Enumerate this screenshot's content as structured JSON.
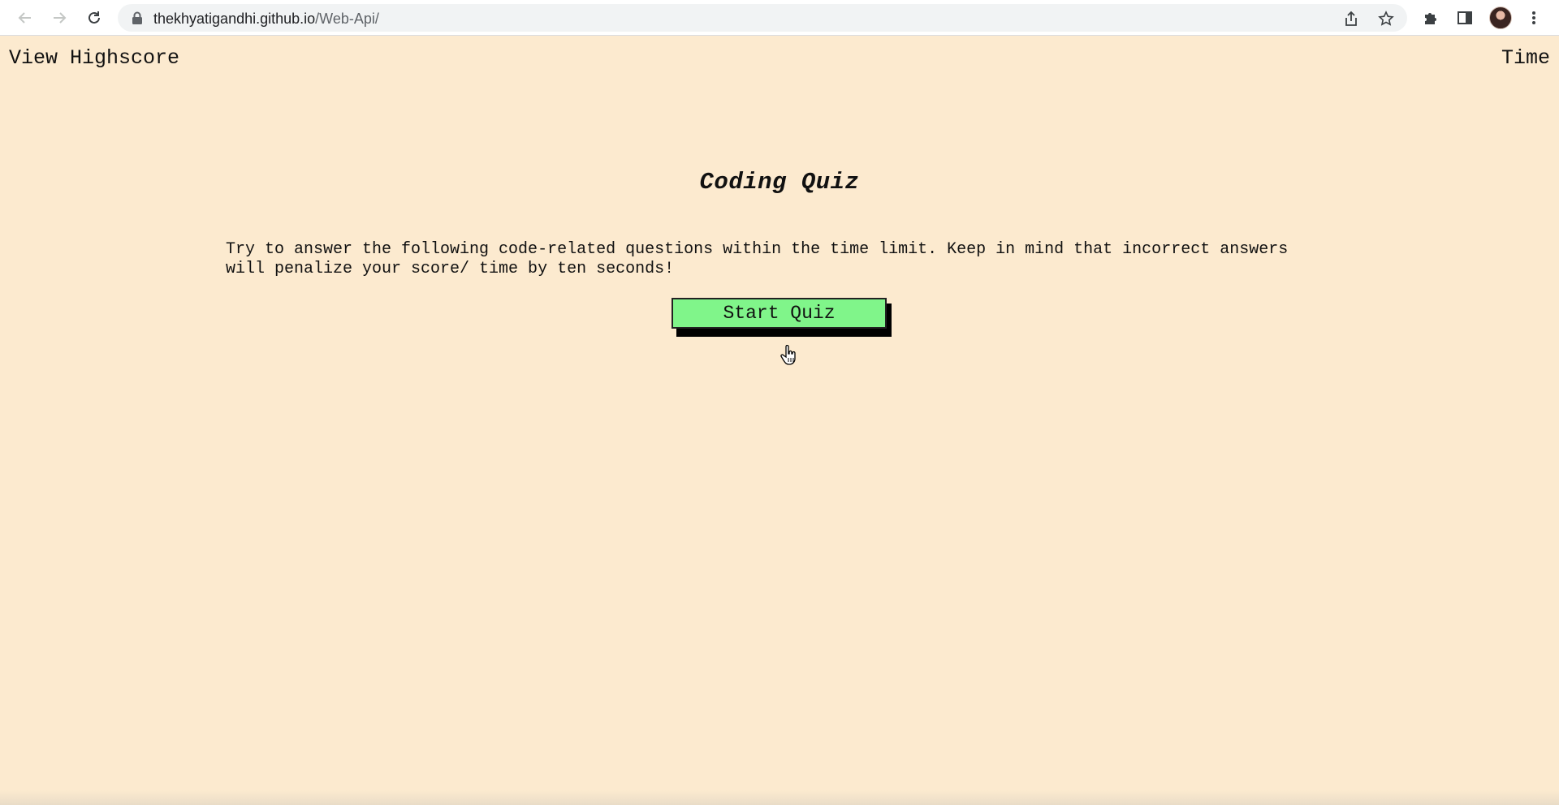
{
  "browser": {
    "url_domain": "thekhyatigandhi.github.io",
    "url_path": "/Web-Api/"
  },
  "icons": {
    "back": "arrow-left-icon",
    "forward": "arrow-right-icon",
    "reload": "reload-icon",
    "lock": "lock-icon",
    "share": "share-icon",
    "bookmark": "star-icon",
    "extensions": "puzzle-icon",
    "side_panel": "side-panel-icon",
    "menu": "kebab-menu-icon",
    "cursor": "hand-pointer-icon"
  },
  "header": {
    "view_highscore": "View Highscore",
    "time_label": "Time"
  },
  "main": {
    "title": "Coding Quiz",
    "description": "Try to answer the following code-related questions within the time limit. Keep in mind that incorrect answers will penalize your score/ time by ten seconds!",
    "start_button": "Start Quiz"
  },
  "colors": {
    "background": "#fceacf",
    "button": "#80f58a",
    "button_shadow": "#000000"
  }
}
